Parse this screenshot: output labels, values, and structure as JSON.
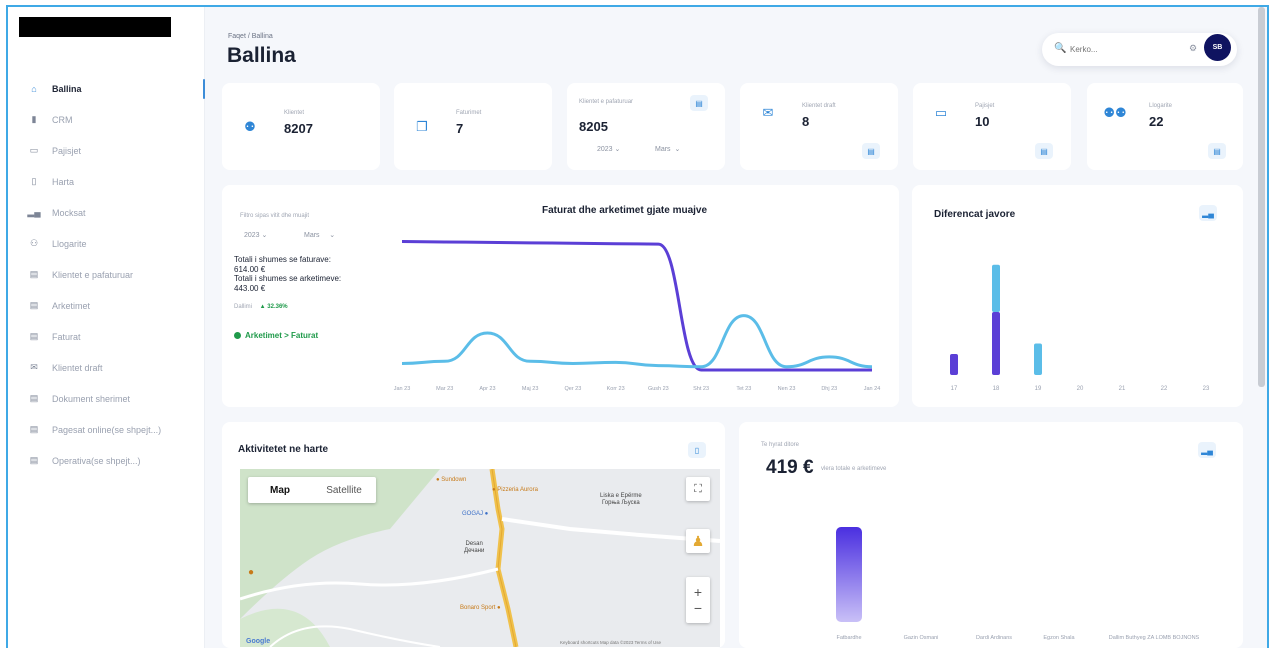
{
  "sidebar": {
    "items": [
      {
        "label": "Ballina",
        "icon": "home-icon",
        "glyph": "⌂",
        "active": true
      },
      {
        "label": "CRM",
        "icon": "crm-icon",
        "glyph": "▮"
      },
      {
        "label": "Pajisjet",
        "icon": "devices-icon",
        "glyph": "▭"
      },
      {
        "label": "Harta",
        "icon": "map-icon",
        "glyph": "▯"
      },
      {
        "label": "Mocksat",
        "icon": "bar-chart-icon",
        "glyph": "▂▄"
      },
      {
        "label": "Llogarite",
        "icon": "users-icon",
        "glyph": "⚇"
      },
      {
        "label": "Klientet e pafaturuar",
        "icon": "list-icon",
        "glyph": "▤"
      },
      {
        "label": "Arketimet",
        "icon": "list-icon",
        "glyph": "▤"
      },
      {
        "label": "Faturat",
        "icon": "list-icon",
        "glyph": "▤"
      },
      {
        "label": "Klientet draft",
        "icon": "envelope-icon",
        "glyph": "✉"
      },
      {
        "label": "Dokument sherimet",
        "icon": "list-icon",
        "glyph": "▤"
      },
      {
        "label": "Pagesat online(se shpejt...)",
        "icon": "list-icon",
        "glyph": "▤"
      },
      {
        "label": "Operativa(se shpejt...)",
        "icon": "list-icon",
        "glyph": "▤"
      }
    ]
  },
  "header": {
    "breadcrumb": "Faqet / Ballina",
    "title": "Ballina",
    "search_placeholder": "Kerko...",
    "avatar_initials": "SB"
  },
  "stats": [
    {
      "label": "Klientet",
      "value": "8207",
      "icon": "users-icon"
    },
    {
      "label": "Faturimet",
      "value": "7",
      "icon": "documents-icon"
    },
    {
      "label": "Klientet e pafaturuar",
      "value": "8205",
      "year": "2023",
      "month": "Mars"
    },
    {
      "label": "Klientet draft",
      "value": "8",
      "icon": "envelope-icon"
    },
    {
      "label": "Pajisjet",
      "value": "10",
      "icon": "devices-icon"
    },
    {
      "label": "Llogarite",
      "value": "22",
      "icon": "user-group-icon"
    }
  ],
  "main_chart": {
    "title": "Faturat dhe arketimet gjate muajve",
    "filter_label": "Filtro sipas vitit dhe muajit",
    "year": "2023",
    "month": "Mars",
    "total_invoiced_label": "Totali i shumes se faturave:",
    "total_invoiced_value": "614.00 €",
    "total_received_label": "Totali i shumes se arketimeve:",
    "total_received_value": "443.00 €",
    "diff_label": "Dallimi",
    "diff_value": "▲ 32.36%",
    "status": "Arketimet > Faturat",
    "colors": {
      "invoices": "#5b3fd6",
      "receipts": "#5bbde8"
    }
  },
  "weekly_chart": {
    "title": "Diferencat javore"
  },
  "map_card": {
    "title": "Aktivitetet ne harte",
    "tab_map": "Map",
    "tab_satellite": "Satellite",
    "places": {
      "liska": "Liska e Epërme",
      "liska_cyr": "Горња Љуска",
      "desan": "Desan",
      "desan_cyr": "Дечани",
      "gogaj": "GOGAJ",
      "pizzeria": "Pizzeria Aurora",
      "bonaro": "Bonaro Sport",
      "sundown": "Sundown"
    },
    "footer": "Keyboard shortcuts   Map data ©2023   Terms of Use",
    "google": "Google"
  },
  "income_card": {
    "label": "Te hyrat ditore",
    "value": "419 €",
    "sub": "vlera totale e arketimeve"
  },
  "chart_data": [
    {
      "type": "line",
      "title": "Faturat dhe arketimet gjate muajve",
      "categories": [
        "Jan 23",
        "Mar 23",
        "Apr 23",
        "Maj 23",
        "Qer 23",
        "Korr 23",
        "Gush 23",
        "Sht 23",
        "Tet 23",
        "Nen 23",
        "Dhj 23",
        "Jan 24"
      ],
      "series": [
        {
          "values": [
            590,
            588,
            586,
            584,
            582,
            580,
            578,
            0,
            0,
            0,
            0,
            0
          ]
        },
        {
          "values": [
            30,
            40,
            170,
            40,
            30,
            35,
            20,
            15,
            250,
            15,
            60,
            15
          ]
        }
      ],
      "ylim": [
        0,
        620
      ]
    },
    {
      "type": "bar",
      "title": "Diferencat javore",
      "categories": [
        "17",
        "18",
        "19",
        "20",
        "21",
        "22",
        "23"
      ],
      "series": [
        {
          "values": [
            20,
            60,
            0,
            0,
            0,
            0,
            0
          ]
        },
        {
          "values": [
            0,
            45,
            30,
            0,
            0,
            0,
            0
          ]
        }
      ]
    },
    {
      "type": "bar",
      "title": "Te hyrat ditore",
      "categories": [
        "Fatbardhe",
        "Gazin Osmani",
        "Dardi Ardinans",
        "Egzon Shala",
        "Dallim Buthyeg ZA LOMB BOJNONS"
      ],
      "values": [
        419,
        0,
        0,
        0,
        0
      ]
    }
  ]
}
